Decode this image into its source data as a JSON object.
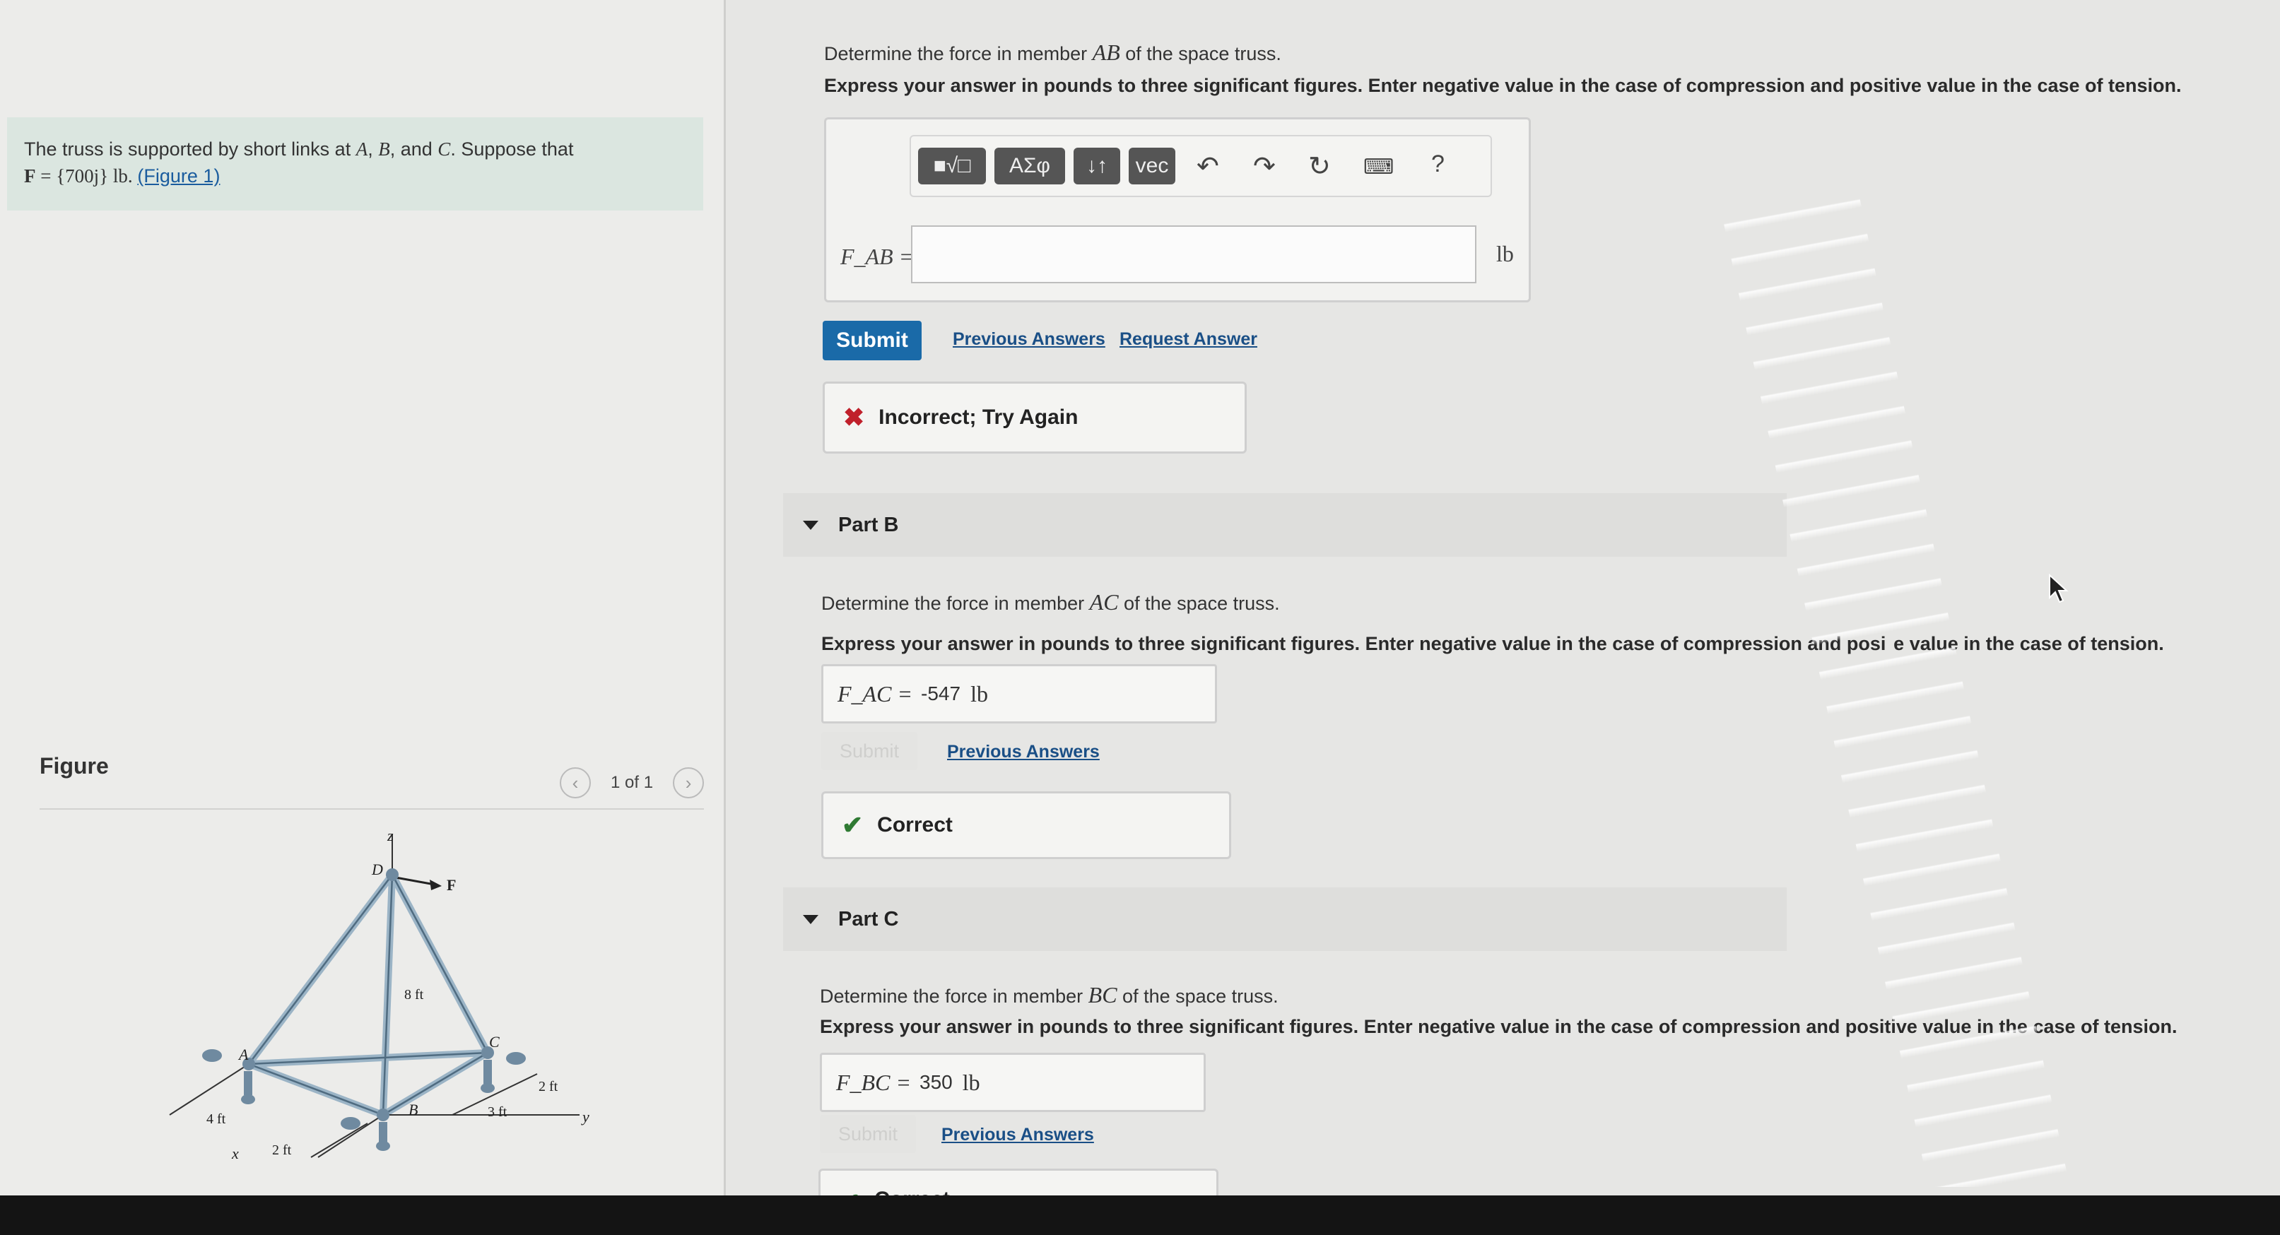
{
  "intro": {
    "line1_pre": "The truss is supported by short links at ",
    "pt_a": "A",
    "sep1": ", ",
    "pt_b": "B",
    "sep2": ", and ",
    "pt_c": "C",
    "line1_post": ". Suppose that",
    "force_symbol": "F",
    "force_eq": " = {700j} lb. ",
    "figure_link": "(Figure 1)"
  },
  "figure": {
    "title": "Figure",
    "pager": "1 of 1",
    "labels": {
      "z": "z",
      "d": "D",
      "f": "F",
      "a": "A",
      "b": "B",
      "c": "C",
      "x": "x",
      "y": "y",
      "h8": "8 ft",
      "w4": "4 ft",
      "w2a": "2 ft",
      "w2b": "2 ft",
      "w3": "3 ft"
    }
  },
  "partA": {
    "prompt_pre": "Determine the force in member ",
    "member": "AB",
    "prompt_post": " of the space truss.",
    "instructions": "Express your answer in pounds to three significant figures. Enter negative value in the case of compression and positive value in the case of tension.",
    "toolbar": {
      "templates": "■√□",
      "greek": "ΑΣφ",
      "arrows": "↓↑",
      "vec": "vec"
    },
    "label": "F_AB =",
    "value": "",
    "unit": "lb",
    "submit": "Submit",
    "previous": "Previous Answers",
    "request": "Request Answer",
    "feedback": "Incorrect; Try Again"
  },
  "partB": {
    "title": "Part B",
    "prompt_pre": "Determine the force in member ",
    "member": "AC",
    "prompt_post": " of the space truss.",
    "instructions": "Express your answer in pounds to three significant figures. Enter negative value in the case of compression and posi  e value in the case of tension.",
    "label": "F_AC =",
    "value": "-547",
    "unit": "lb",
    "submit": "Submit",
    "previous": "Previous Answers",
    "feedback": "Correct"
  },
  "partC": {
    "title": "Part C",
    "prompt_pre": "Determine the force in member ",
    "member": "BC",
    "prompt_post": " of the space truss.",
    "instructions": "Express your answer in pounds to three significant figures. Enter negative value in the case of compression and positive value in the case of tension.",
    "label": "F_BC =",
    "value": "350",
    "unit": "lb",
    "submit": "Submit",
    "previous": "Previous Answers",
    "feedback": "Correct"
  },
  "colors": {
    "accent": "#1a6aa8",
    "incorrect": "#c0202b",
    "correct": "#2f7a33",
    "intro_bg": "#dbe6e0"
  }
}
